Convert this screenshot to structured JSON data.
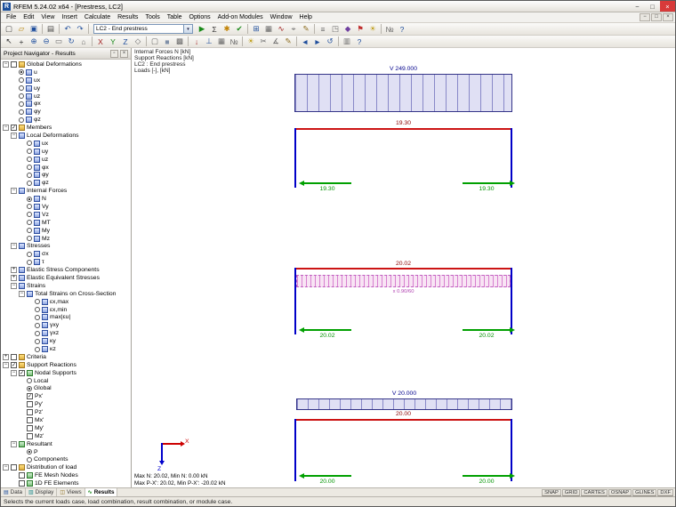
{
  "window": {
    "title": "RFEM 5.24.02 x64 - [Prestress, LC2]",
    "app_icon_text": "R",
    "buttons": {
      "min": "−",
      "max": "□",
      "close": "×"
    },
    "mdi_buttons": [
      "−",
      "□",
      "×"
    ]
  },
  "menu": {
    "items": [
      "File",
      "Edit",
      "View",
      "Insert",
      "Calculate",
      "Results",
      "Tools",
      "Table",
      "Options",
      "Add-on Modules",
      "Window",
      "Help"
    ]
  },
  "toolbar1": {
    "combo_value": "LC2 - End prestress",
    "combo_arrow": "▼",
    "icons_before": [
      {
        "n": "new-icon",
        "g": "▢",
        "c": "#444444"
      },
      {
        "n": "open-icon",
        "g": "▱",
        "c": "#b8860b"
      },
      {
        "n": "save-icon",
        "g": "▣",
        "c": "#1f4e9c"
      },
      "|",
      {
        "n": "print-icon",
        "g": "▤",
        "c": "#444444"
      },
      "|",
      {
        "n": "undo-icon",
        "g": "↶",
        "c": "#1f4e9c"
      },
      {
        "n": "redo-icon",
        "g": "↷",
        "c": "#1f4e9c"
      },
      "|"
    ],
    "icons_after": [
      {
        "n": "go-calculate-icon",
        "g": "▶",
        "c": "#1a8a1a"
      },
      {
        "n": "calculation-sigma-icon",
        "g": "Σ",
        "c": "#333333"
      },
      {
        "n": "generate-icon",
        "g": "✱",
        "c": "#c08000"
      },
      {
        "n": "check-icon",
        "g": "✔",
        "c": "#1a8a1a"
      },
      "|",
      {
        "n": "tables-icon",
        "g": "⊞",
        "c": "#1f4e9c"
      },
      {
        "n": "grid-icon",
        "g": "▦",
        "c": "#666666"
      },
      {
        "n": "result-diagram-icon",
        "g": "∿",
        "c": "#a02020"
      },
      {
        "n": "snap-target-icon",
        "g": "⌖",
        "c": "#666666"
      },
      {
        "n": "edit-icon",
        "g": "✎",
        "c": "#8a6a1a"
      },
      "|",
      {
        "n": "layers-icon",
        "g": "≡",
        "c": "#666666"
      },
      {
        "n": "window-icon",
        "g": "◳",
        "c": "#666666"
      },
      {
        "n": "render-icon",
        "g": "◆",
        "c": "#7040a0"
      },
      {
        "n": "flag-icon",
        "g": "⚑",
        "c": "#c03030"
      },
      {
        "n": "display-icon",
        "g": "☀",
        "c": "#c0a020"
      },
      "|",
      {
        "n": "numbering-icon",
        "g": "№",
        "c": "#666666"
      },
      {
        "n": "help-icon",
        "g": "?",
        "c": "#1f4e9c"
      }
    ]
  },
  "toolbar2": {
    "icons": [
      {
        "n": "select-icon",
        "g": "↖",
        "c": "#333333"
      },
      {
        "n": "pan-icon",
        "g": "+",
        "c": "#333333"
      },
      {
        "n": "zoom-in-icon",
        "g": "⊕",
        "c": "#1f4e9c"
      },
      {
        "n": "zoom-out-icon",
        "g": "⊖",
        "c": "#1f4e9c"
      },
      {
        "n": "zoom-window-icon",
        "g": "▭",
        "c": "#666666"
      },
      {
        "n": "rotate-view-icon",
        "g": "↻",
        "c": "#1f4e9c"
      },
      {
        "n": "home-view-icon",
        "g": "⌂",
        "c": "#666666"
      },
      "|",
      {
        "n": "view-x-icon",
        "g": "X",
        "c": "#a02020"
      },
      {
        "n": "view-y-icon",
        "g": "Y",
        "c": "#1a8a1a"
      },
      {
        "n": "view-z-icon",
        "g": "Z",
        "c": "#1f4e9c"
      },
      {
        "n": "isometric-view-icon",
        "g": "◇",
        "c": "#666666"
      },
      "|",
      {
        "n": "wireframe-icon",
        "g": "▢",
        "c": "#666666"
      },
      {
        "n": "solid-model-icon",
        "g": "■",
        "c": "#8090a8"
      },
      {
        "n": "hidden-line-icon",
        "g": "▩",
        "c": "#666666"
      },
      "|",
      {
        "n": "show-loads-icon",
        "g": "↓",
        "c": "#a02020"
      },
      {
        "n": "show-supports-icon",
        "g": "⊥",
        "c": "#1f4e9c"
      },
      {
        "n": "show-mesh-icon",
        "g": "▦",
        "c": "#666666"
      },
      {
        "n": "show-numbers-icon",
        "g": "№",
        "c": "#666666"
      },
      "|",
      {
        "n": "light-icon",
        "g": "☀",
        "c": "#c0a020"
      },
      {
        "n": "clip-icon",
        "g": "✂",
        "c": "#666666"
      },
      {
        "n": "measure-icon",
        "g": "∡",
        "c": "#666666"
      },
      {
        "n": "annotate-icon",
        "g": "✎",
        "c": "#8a6a1a"
      },
      "|",
      {
        "n": "previous-view-icon",
        "g": "◄",
        "c": "#1f4e9c"
      },
      {
        "n": "next-view-icon",
        "g": "►",
        "c": "#1f4e9c"
      },
      {
        "n": "refresh-icon",
        "g": "↺",
        "c": "#1f4e9c"
      },
      "|",
      {
        "n": "panel-toggle-icon",
        "g": "▥",
        "c": "#666666"
      },
      {
        "n": "help2-icon",
        "g": "?",
        "c": "#1f4e9c"
      }
    ]
  },
  "navigator": {
    "title": "Project Navigator - Results",
    "pin_icon": "▫",
    "close_icon": "×",
    "active_tab": "Results",
    "tabs": [
      {
        "label": "Data",
        "icon": "▤",
        "color": "#1f4e9c"
      },
      {
        "label": "Display",
        "icon": "▥",
        "color": "#1a8a8a"
      },
      {
        "label": "Views",
        "icon": "◫",
        "color": "#8a6a1a"
      },
      {
        "label": "Results",
        "icon": "∿",
        "color": "#1a8a1a"
      }
    ],
    "tree": [
      {
        "indent": 0,
        "exp": "-",
        "ctrl": "check",
        "on": false,
        "icon": "folder",
        "label": "Global Deformations"
      },
      {
        "indent": 1,
        "ctrl": "radio",
        "on": true,
        "icon": "diag",
        "label": "u"
      },
      {
        "indent": 1,
        "ctrl": "radio",
        "on": false,
        "icon": "diag",
        "label": "ux"
      },
      {
        "indent": 1,
        "ctrl": "radio",
        "on": false,
        "icon": "diag",
        "label": "uy"
      },
      {
        "indent": 1,
        "ctrl": "radio",
        "on": false,
        "icon": "diag",
        "label": "uz"
      },
      {
        "indent": 1,
        "ctrl": "radio",
        "on": false,
        "icon": "diag",
        "label": "φx"
      },
      {
        "indent": 1,
        "ctrl": "radio",
        "on": false,
        "icon": "diag",
        "label": "φy"
      },
      {
        "indent": 1,
        "ctrl": "radio",
        "on": false,
        "icon": "diag",
        "label": "φz"
      },
      {
        "indent": 0,
        "exp": "-",
        "ctrl": "check",
        "on": true,
        "icon": "folder",
        "label": "Members"
      },
      {
        "indent": 1,
        "exp": "-",
        "icon": "diag",
        "label": "Local Deformations"
      },
      {
        "indent": 2,
        "ctrl": "radio",
        "on": false,
        "icon": "diag",
        "label": "ux"
      },
      {
        "indent": 2,
        "ctrl": "radio",
        "on": false,
        "icon": "diag",
        "label": "uy"
      },
      {
        "indent": 2,
        "ctrl": "radio",
        "on": false,
        "icon": "diag",
        "label": "uz"
      },
      {
        "indent": 2,
        "ctrl": "radio",
        "on": false,
        "icon": "diag",
        "label": "φx"
      },
      {
        "indent": 2,
        "ctrl": "radio",
        "on": false,
        "icon": "diag",
        "label": "φy"
      },
      {
        "indent": 2,
        "ctrl": "radio",
        "on": false,
        "icon": "diag",
        "label": "φz"
      },
      {
        "indent": 1,
        "exp": "-",
        "icon": "diag",
        "label": "Internal Forces"
      },
      {
        "indent": 2,
        "ctrl": "radio",
        "on": true,
        "icon": "diag",
        "label": "N"
      },
      {
        "indent": 2,
        "ctrl": "radio",
        "on": false,
        "icon": "diag",
        "label": "Vy"
      },
      {
        "indent": 2,
        "ctrl": "radio",
        "on": false,
        "icon": "diag",
        "label": "Vz"
      },
      {
        "indent": 2,
        "ctrl": "radio",
        "on": false,
        "icon": "diag",
        "label": "MT"
      },
      {
        "indent": 2,
        "ctrl": "radio",
        "on": false,
        "icon": "diag",
        "label": "My"
      },
      {
        "indent": 2,
        "ctrl": "radio",
        "on": false,
        "icon": "diag",
        "label": "Mz"
      },
      {
        "indent": 1,
        "exp": "-",
        "icon": "diag",
        "label": "Stresses"
      },
      {
        "indent": 2,
        "ctrl": "radio",
        "on": false,
        "icon": "diag",
        "label": "σx"
      },
      {
        "indent": 2,
        "ctrl": "radio",
        "on": false,
        "icon": "diag",
        "label": "τ"
      },
      {
        "indent": 1,
        "exp": "+",
        "icon": "diag",
        "label": "Elastic Stress Components"
      },
      {
        "indent": 1,
        "exp": "+",
        "icon": "diag",
        "label": "Elastic Equivalent Stresses"
      },
      {
        "indent": 1,
        "exp": "-",
        "icon": "diag",
        "label": "Strains"
      },
      {
        "indent": 2,
        "exp": "-",
        "icon": "diag",
        "label": "Total Strains on Cross-Section"
      },
      {
        "indent": 3,
        "ctrl": "radio",
        "on": false,
        "icon": "diag",
        "label": "εx,max"
      },
      {
        "indent": 3,
        "ctrl": "radio",
        "on": false,
        "icon": "diag",
        "label": "εx,min"
      },
      {
        "indent": 3,
        "ctrl": "radio",
        "on": false,
        "icon": "diag",
        "label": "max|εu|"
      },
      {
        "indent": 3,
        "ctrl": "radio",
        "on": false,
        "icon": "diag",
        "label": "γxy"
      },
      {
        "indent": 3,
        "ctrl": "radio",
        "on": false,
        "icon": "diag",
        "label": "γxz"
      },
      {
        "indent": 3,
        "ctrl": "radio",
        "on": false,
        "icon": "diag",
        "label": "κy"
      },
      {
        "indent": 3,
        "ctrl": "radio",
        "on": false,
        "icon": "diag",
        "label": "κz"
      },
      {
        "indent": 0,
        "exp": "+",
        "ctrl": "check",
        "on": false,
        "icon": "folder",
        "label": "Criteria"
      },
      {
        "indent": 0,
        "exp": "-",
        "ctrl": "check",
        "on": true,
        "icon": "folder",
        "label": "Support Reactions"
      },
      {
        "indent": 1,
        "exp": "-",
        "ctrl": "check",
        "on": true,
        "icon": "node",
        "label": "Nodal Supports"
      },
      {
        "indent": 2,
        "ctrl": "radio",
        "on": false,
        "label": "Local"
      },
      {
        "indent": 2,
        "ctrl": "radio",
        "on": true,
        "label": "Global"
      },
      {
        "indent": 2,
        "ctrl": "check",
        "on": true,
        "label": "Px'"
      },
      {
        "indent": 2,
        "ctrl": "check",
        "on": false,
        "label": "Py'"
      },
      {
        "indent": 2,
        "ctrl": "check",
        "on": false,
        "label": "Pz'"
      },
      {
        "indent": 2,
        "ctrl": "check",
        "on": false,
        "label": "Mx'"
      },
      {
        "indent": 2,
        "ctrl": "check",
        "on": false,
        "label": "My'"
      },
      {
        "indent": 2,
        "ctrl": "check",
        "on": false,
        "label": "Mz'"
      },
      {
        "indent": 1,
        "exp": "-",
        "icon": "node",
        "label": "Resultant"
      },
      {
        "indent": 2,
        "ctrl": "radio",
        "on": true,
        "label": "P"
      },
      {
        "indent": 2,
        "ctrl": "radio",
        "on": false,
        "label": "Components"
      },
      {
        "indent": 0,
        "exp": "-",
        "ctrl": "check",
        "on": false,
        "icon": "folder",
        "label": "Distribution of load"
      },
      {
        "indent": 1,
        "ctrl": "check",
        "on": false,
        "icon": "node",
        "label": "FE Mesh Nodes"
      },
      {
        "indent": 1,
        "ctrl": "check",
        "on": false,
        "icon": "node",
        "label": "1D FE Elements"
      }
    ]
  },
  "canvas": {
    "info_lines": [
      "Internal Forces N [kN]",
      "Support Reactions [kN]",
      "LC2 : End prestress",
      "Loads [-], [kN]"
    ],
    "top_load_label": "V 249.000",
    "frame1": {
      "beam": "19.30",
      "left": "19.30",
      "right": "19.30"
    },
    "frame2": {
      "beam": "20.02",
      "strip": "x 0.90/60",
      "left": "20.02",
      "right": "20.02"
    },
    "bottom_load_label": "V 20.000",
    "frame3": {
      "beam": "20.00",
      "left": "20.00",
      "right": "20.00"
    },
    "axis": {
      "x": "X",
      "z": "Z"
    },
    "stats_line1": "Max N: 20.02, Min N: 0.00 kN",
    "stats_line2": "Max P-X': 20.02, Min P-X': -20.02 kN"
  },
  "statusbar": {
    "hint": "Selects the current loads case, load combination, result combination, or module case.",
    "buttons": [
      "SNAP",
      "GRID",
      "CARTES",
      "OSNAP",
      "GLINES",
      "DXF"
    ]
  }
}
